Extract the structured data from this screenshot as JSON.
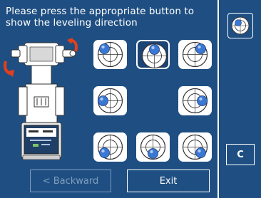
{
  "prompt": {
    "text": "Please press the appropriate button to show the leveling direction"
  },
  "leveling_buttons": [
    {
      "id": "top-left",
      "direction": "top-left",
      "selected": false
    },
    {
      "id": "top",
      "direction": "top",
      "selected": true
    },
    {
      "id": "top-right",
      "direction": "top-right",
      "selected": false
    },
    {
      "id": "left",
      "direction": "left",
      "selected": false
    },
    {
      "id": "right",
      "direction": "right",
      "selected": false
    },
    {
      "id": "bottom-left",
      "direction": "bottom-left",
      "selected": false
    },
    {
      "id": "bottom",
      "direction": "bottom",
      "selected": false
    },
    {
      "id": "bottom-right",
      "direction": "bottom-right",
      "selected": false
    }
  ],
  "footer": {
    "backward_label": "< Backward",
    "exit_label": "Exit"
  },
  "sidebar": {
    "clear_label": "C",
    "level_icon": "level-bubble-icon"
  },
  "colors": {
    "panel": "#1f4f82",
    "accent_arrow": "#e2401c",
    "bubble": "#3a78d4",
    "disabled_text": "#7f9dc0"
  }
}
